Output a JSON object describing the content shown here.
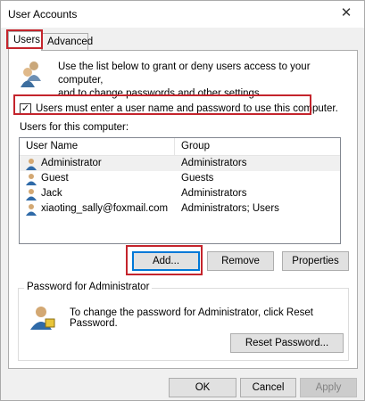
{
  "window": {
    "title": "User Accounts",
    "close_glyph": "✕"
  },
  "tabs": [
    {
      "label": "Users",
      "active": true
    },
    {
      "label": "Advanced",
      "active": false
    }
  ],
  "intro": {
    "line1": "Use the list below to grant or deny users access to your computer,",
    "line2": "and to change passwords and other settings."
  },
  "require_login": {
    "label": "Users must enter a user name and password to use this computer.",
    "checked": true,
    "check_glyph": "✓"
  },
  "users_list": {
    "label": "Users for this computer:",
    "columns": [
      "User Name",
      "Group"
    ],
    "rows": [
      {
        "name": "Administrator",
        "group": "Administrators",
        "selected": true
      },
      {
        "name": "Guest",
        "group": "Guests",
        "selected": false
      },
      {
        "name": "Jack",
        "group": "Administrators",
        "selected": false
      },
      {
        "name": "xiaoting_sally@foxmail.com",
        "group": "Administrators; Users",
        "selected": false
      }
    ]
  },
  "list_buttons": {
    "add": "Add...",
    "remove": "Remove",
    "properties": "Properties"
  },
  "password_group": {
    "title": "Password for Administrator",
    "text": "To change the password for Administrator, click Reset Password.",
    "reset_button": "Reset Password..."
  },
  "footer": {
    "ok": "OK",
    "cancel": "Cancel",
    "apply": "Apply"
  },
  "colors": {
    "highlight": "#c4242c",
    "focus": "#0078d7",
    "panel": "#ffffff",
    "chrome": "#f0f0f0"
  }
}
